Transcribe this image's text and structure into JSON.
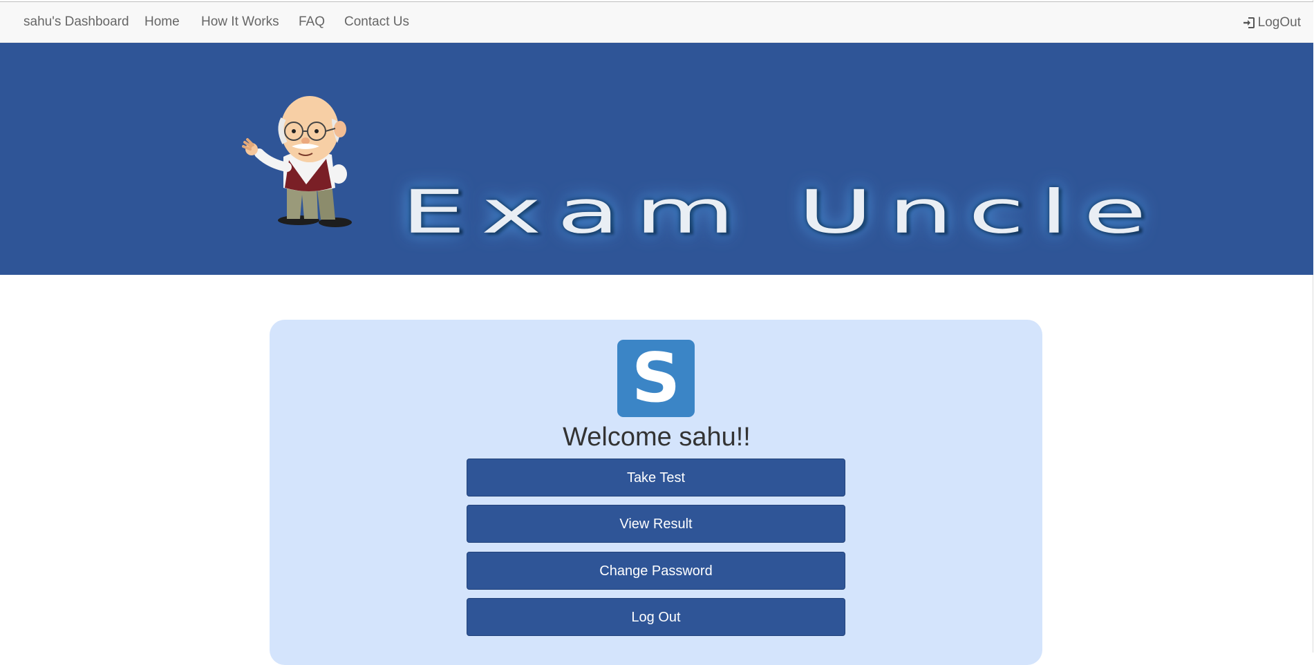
{
  "navbar": {
    "brand": "sahu's Dashboard",
    "links": [
      "Home",
      "How It Works",
      "FAQ",
      "Contact Us"
    ],
    "logout_label": "LogOut",
    "logout_icon": "login-icon"
  },
  "banner": {
    "title": "Exam Uncle",
    "background_color": "#2f5597",
    "mascot": "cartoon-uncle-waving"
  },
  "profile": {
    "avatar_letter": "S",
    "avatar_color": "#3b85c6",
    "welcome": "Welcome sahu!!",
    "card_color": "#d4e4fc"
  },
  "actions": {
    "take_test": "Take Test",
    "view_result": "View Result",
    "change_password": "Change Password",
    "log_out": "Log Out",
    "button_color": "#2f5597"
  }
}
